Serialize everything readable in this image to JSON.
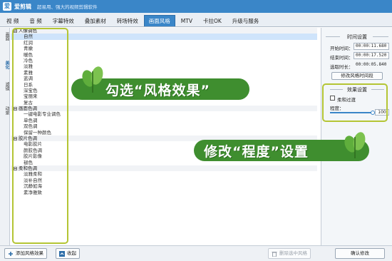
{
  "titlebar": {
    "app_name": "爱剪辑",
    "slogan": "超易用、强大的视频剪辑软件",
    "logo_glyph": "爱"
  },
  "tabs": [
    {
      "label": "视 频",
      "active": false
    },
    {
      "label": "音 频",
      "active": false
    },
    {
      "label": "字幕特效",
      "active": false
    },
    {
      "label": "叠加素材",
      "active": false
    },
    {
      "label": "转场特效",
      "active": false
    },
    {
      "label": "画面风格",
      "active": true
    },
    {
      "label": "MTV",
      "active": false
    },
    {
      "label": "卡拉OK",
      "active": false
    },
    {
      "label": "升级与服务",
      "active": false
    }
  ],
  "side_strip": [
    {
      "label": "画面",
      "active": false
    },
    {
      "label": "美化",
      "active": true
    },
    {
      "label": "滤镜",
      "active": false
    },
    {
      "label": "动景",
      "active": false
    }
  ],
  "style_list": {
    "categories": [
      {
        "name": "人像调色",
        "items": [
          "自然",
          "红润",
          "青嫩",
          "暖色",
          "冷色",
          "淡雅",
          "素雅",
          "蓝调",
          "日系",
          "深宝色",
          "宝丽来",
          "复古"
        ]
      },
      {
        "name": "画面色调",
        "items": [
          "一键电影专业调色",
          "单色调",
          "双色调",
          "保留一种颜色"
        ]
      },
      {
        "name": "胶片色调",
        "items": [
          "电影胶片",
          "颜胶色调",
          "胶片影像",
          "褪色"
        ]
      },
      {
        "name": "柔和色调",
        "items": [
          "淡雅柔和",
          "淡补自然",
          "沉静如海",
          "素净雅致"
        ]
      }
    ],
    "selected_item": "自然"
  },
  "time_settings": {
    "title": "时间设置",
    "start_label": "开始时间：",
    "start_value": "00:00:11.680",
    "end_label": "结束时间：",
    "end_value": "00:00:17.520",
    "duration_label": "选取时长：",
    "duration_value": "00:00:05.840",
    "modify_button": "修改风格时间段"
  },
  "effect_settings": {
    "title": "效果设置",
    "checkbox_label": "柔和过渡",
    "checkbox_checked": false,
    "degree_label": "程度：",
    "degree_value": "100",
    "degree_fraction": 1.0
  },
  "bottom_bar": {
    "add_button": "添加风格效果",
    "collapse_button": "收起",
    "delete_button": "删除选中风格",
    "confirm_button": "确认修改"
  },
  "annotations": {
    "banner1": "勾选“风格效果”",
    "banner2": "修改“程度”设置"
  },
  "colors": {
    "accent": "#3a86c8",
    "banner_green": "#3f8e2f",
    "highlight_outline": "#b4c534"
  }
}
